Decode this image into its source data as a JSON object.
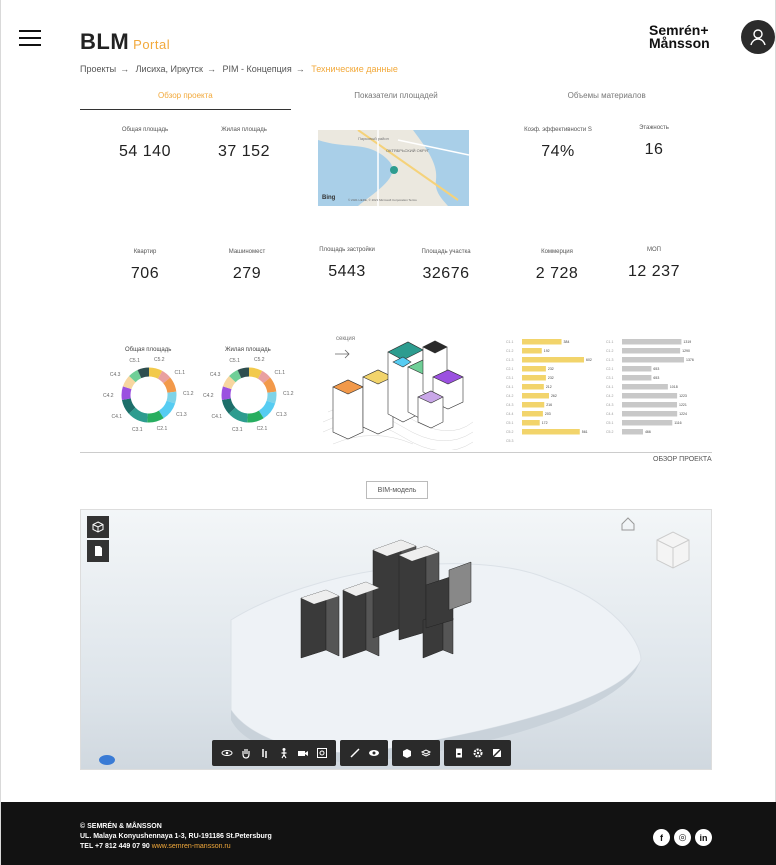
{
  "header": {
    "logo": "BLM",
    "logo_sub": "Portal",
    "brand_line1": "Semrén+",
    "brand_line2": "Månsson",
    "menu_icon": "hamburger-icon",
    "avatar_icon": "user-icon"
  },
  "breadcrumb": [
    "Проекты",
    "Лисиха, Иркутск",
    "PIM - Концепция",
    "Технические данные"
  ],
  "breadcrumb_sep": "→",
  "tabs": [
    "Обзор проекта",
    "Показатели площадей",
    "Объемы материалов"
  ],
  "stats_top": [
    {
      "label": "Общая площадь",
      "value": "54 140"
    },
    {
      "label": "Жилая площадь",
      "value": "37 152"
    },
    {
      "label": "Коэф. эффективности S",
      "value": "74%"
    },
    {
      "label": "Этажность",
      "value": "16"
    }
  ],
  "map": {
    "label_district": "ОКТЯБРЬСКИЙ ОКРУГ",
    "label_area": "Парковый район",
    "provider": "Bing",
    "copyright": "© 2021 HERE, © 2021 Microsoft Corporation  Terms"
  },
  "stats_mid": [
    {
      "label": "Квартир",
      "value": "706"
    },
    {
      "label": "Машиномест",
      "value": "279"
    },
    {
      "label": "Площадь застройки",
      "value": "5443"
    },
    {
      "label": "Площадь участка",
      "value": "32676"
    },
    {
      "label": "Коммерция",
      "value": "2 728"
    },
    {
      "label": "МОП",
      "value": "12 237"
    }
  ],
  "donuts": [
    {
      "title": "Общая площадь",
      "labels": [
        "C5.1",
        "C5.2",
        "C1.1",
        "C1.2",
        "C1.3",
        "C2.1",
        "C3.1",
        "C4.1",
        "C4.2",
        "C4.3"
      ]
    },
    {
      "title": "Жилая площадь",
      "labels": [
        "C5.1",
        "C5.2",
        "C1.1",
        "C1.2",
        "C1.3",
        "C2.1",
        "C3.1",
        "C4.1",
        "C4.2",
        "C4.3"
      ]
    }
  ],
  "donut_colors": [
    "#f2c94c",
    "#e9a0a0",
    "#f2994a",
    "#7ed3e8",
    "#56ccf2",
    "#27ae60",
    "#2d9c8f",
    "#1d6f6a",
    "#9b51e0",
    "#f7d6a0",
    "#6fcf97",
    "#2f4f4f"
  ],
  "donut_values": [
    8,
    6,
    9,
    7,
    11,
    10,
    12,
    9,
    8,
    7,
    6,
    7
  ],
  "iso_label": "секция",
  "bars_yellow": {
    "categories": [
      "C1.1",
      "C1.2",
      "C1.3",
      "C2.1",
      "C3.1",
      "C4.1",
      "C4.2",
      "C4.3",
      "C4.4",
      "C5.1",
      "C5.2",
      "C5.3"
    ],
    "values": [
      384,
      192,
      602,
      232,
      232,
      212,
      262,
      216,
      203,
      172,
      561,
      0
    ],
    "color": "#f2d46b"
  },
  "bars_grey": {
    "categories": [
      "C1.1",
      "C1.2",
      "C1.3",
      "C2.1",
      "C3.1",
      "C4.1",
      "C4.2",
      "C4.3",
      "C4.4",
      "C5.1",
      "C5.2"
    ],
    "values": [
      1319,
      1290,
      1376,
      653,
      653,
      1018,
      1223,
      1221,
      1224,
      1116,
      466
    ],
    "color": "#c8c8c8"
  },
  "overview_link": "ОБЗОР ПРОЕКТА",
  "bim_button": "BIM-модель",
  "viewer": {
    "side_buttons": [
      "cube-icon",
      "document-icon"
    ],
    "toolbar_groups": [
      [
        "orbit-icon",
        "pan-hand-icon",
        "walk-icon",
        "person-icon",
        "camera-icon",
        "fit-view-icon"
      ],
      [
        "measure-icon",
        "eye-icon"
      ],
      [
        "explode-icon",
        "section-icon"
      ],
      [
        "properties-icon",
        "settings-icon",
        "fullscreen-icon"
      ]
    ]
  },
  "footer": {
    "line1": "© SEMRÉN & MÅNSSON",
    "line2": "UL. Malaya Konyushennaya 1-3, RU-191186 St.Petersburg",
    "line3_prefix": "TEL +7 812 449 07 90",
    "line3_link": "www.semren-mansson.ru",
    "socials": [
      "f",
      "◎",
      "in"
    ]
  }
}
